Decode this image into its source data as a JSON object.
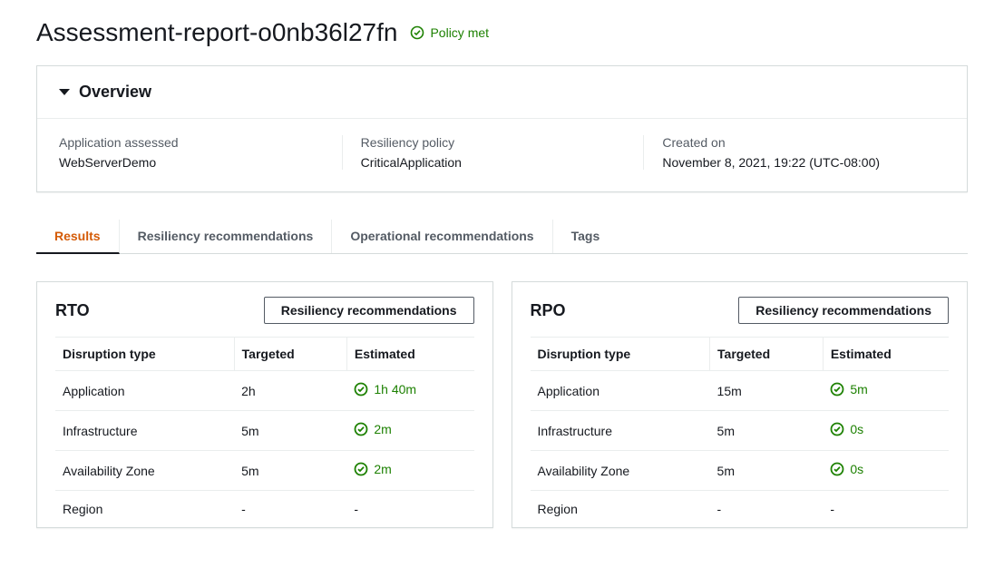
{
  "title": "Assessment-report-o0nb36l27fn",
  "policy_status": "Policy met",
  "overview": {
    "header": "Overview",
    "fields": [
      {
        "label": "Application assessed",
        "value": "WebServerDemo"
      },
      {
        "label": "Resiliency policy",
        "value": "CriticalApplication"
      },
      {
        "label": "Created on",
        "value": "November 8, 2021, 19:22 (UTC-08:00)"
      }
    ]
  },
  "tabs": [
    {
      "label": "Results",
      "active": true
    },
    {
      "label": "Resiliency recommendations",
      "active": false
    },
    {
      "label": "Operational recommendations",
      "active": false
    },
    {
      "label": "Tags",
      "active": false
    }
  ],
  "button_label": "Resiliency recommendations",
  "columns": {
    "c0": "Disruption type",
    "c1": "Targeted",
    "c2": "Estimated"
  },
  "rto": {
    "title": "RTO",
    "rows": [
      {
        "type": "Application",
        "targeted": "2h",
        "estimated": "1h 40m",
        "ok": true
      },
      {
        "type": "Infrastructure",
        "targeted": "5m",
        "estimated": "2m",
        "ok": true
      },
      {
        "type": "Availability Zone",
        "targeted": "5m",
        "estimated": "2m",
        "ok": true
      },
      {
        "type": "Region",
        "targeted": "-",
        "estimated": "-",
        "ok": false
      }
    ]
  },
  "rpo": {
    "title": "RPO",
    "rows": [
      {
        "type": "Application",
        "targeted": "15m",
        "estimated": "5m",
        "ok": true
      },
      {
        "type": "Infrastructure",
        "targeted": "5m",
        "estimated": "0s",
        "ok": true
      },
      {
        "type": "Availability Zone",
        "targeted": "5m",
        "estimated": "0s",
        "ok": true
      },
      {
        "type": "Region",
        "targeted": "-",
        "estimated": "-",
        "ok": false
      }
    ]
  }
}
